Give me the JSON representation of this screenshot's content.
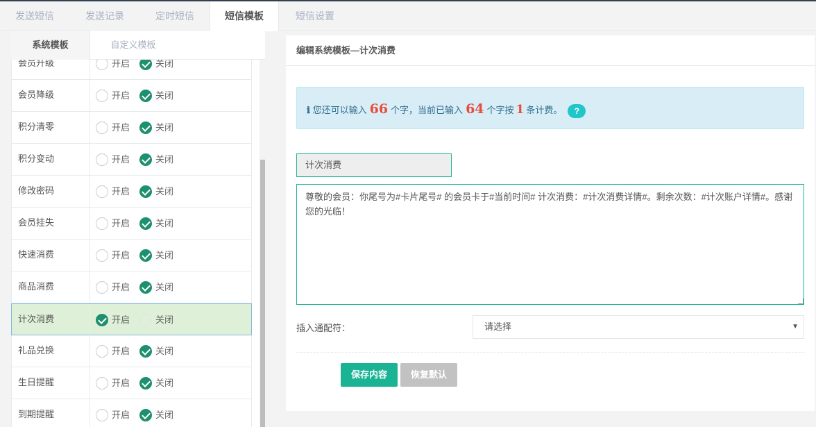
{
  "top_tabs": [
    {
      "label": "发送短信"
    },
    {
      "label": "发送记录"
    },
    {
      "label": "定时短信"
    },
    {
      "label": "短信模板"
    },
    {
      "label": "短信设置"
    }
  ],
  "sub_tabs": {
    "system": "系统模板",
    "custom": "自定义模板"
  },
  "options": {
    "on": "开启",
    "off": "关闭"
  },
  "template_rows": [
    {
      "name": "会员升级",
      "state": "off"
    },
    {
      "name": "会员降级",
      "state": "off"
    },
    {
      "name": "积分清零",
      "state": "off"
    },
    {
      "name": "积分变动",
      "state": "off"
    },
    {
      "name": "修改密码",
      "state": "off"
    },
    {
      "name": "会员挂失",
      "state": "off"
    },
    {
      "name": "快速消费",
      "state": "off"
    },
    {
      "name": "商品消费",
      "state": "off"
    },
    {
      "name": "计次消费",
      "state": "on",
      "selected": true
    },
    {
      "name": "礼品兑换",
      "state": "off"
    },
    {
      "name": "生日提醒",
      "state": "off"
    },
    {
      "name": "到期提醒",
      "state": "off"
    }
  ],
  "editor": {
    "title": "编辑系统模板—计次消费",
    "info": {
      "icon": "info-icon",
      "prefix": "您还可以输入",
      "remaining": "66",
      "middle1": "个字，当前已输入",
      "entered": "64",
      "middle2": "个字按",
      "count": "1",
      "suffix": "条计费。",
      "help": "?"
    },
    "template_name": "计次消费",
    "content": "尊敬的会员：你尾号为#卡片尾号# 的会员卡于#当前时间# 计次消费：#计次消费详情#。剩余次数：#计次账户详情#。感谢您的光临！",
    "insert_label": "插入通配符：",
    "insert_select": "请选择",
    "save_label": "保存内容",
    "reset_label": "恢复默认"
  },
  "colors": {
    "accent": "#1ab394",
    "selected_row": "#dff0d8",
    "info_bg": "#d9edf7",
    "highlight_number": "#e74c3c"
  }
}
